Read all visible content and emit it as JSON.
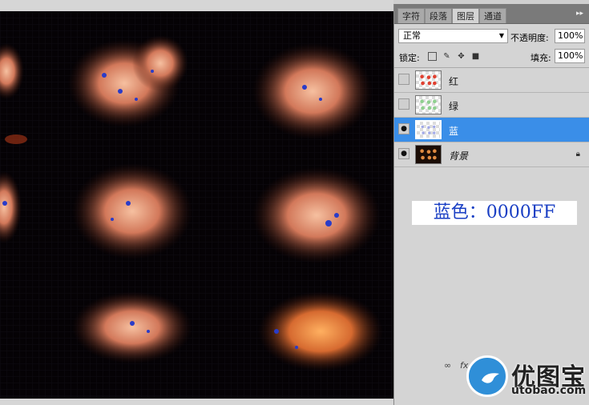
{
  "panel": {
    "tabs": [
      "字符",
      "段落",
      "图层",
      "通道"
    ],
    "active_tab": "图层",
    "menu_glyph": "▸▸",
    "blend_mode": "正常",
    "opacity_label": "不透明度:",
    "opacity_value": "100%",
    "lock_label": "锁定:",
    "fill_label": "填充:",
    "fill_value": "100%"
  },
  "layers": [
    {
      "name": "红",
      "visible": false,
      "selected": false,
      "thumb_color": "#e04030"
    },
    {
      "name": "绿",
      "visible": false,
      "selected": false,
      "thumb_color": "#40c040"
    },
    {
      "name": "蓝",
      "visible": true,
      "selected": true,
      "thumb_color": "#3050e0"
    },
    {
      "name": "背景",
      "visible": true,
      "selected": false,
      "locked": true
    }
  ],
  "note": "蓝色：0000FF",
  "watermark": {
    "name": "优图宝",
    "url": "utobao.com"
  },
  "colors": {
    "accent": "#3a8ee8",
    "note_text": "#1a3fc4",
    "canvas_bg": "#050205"
  }
}
